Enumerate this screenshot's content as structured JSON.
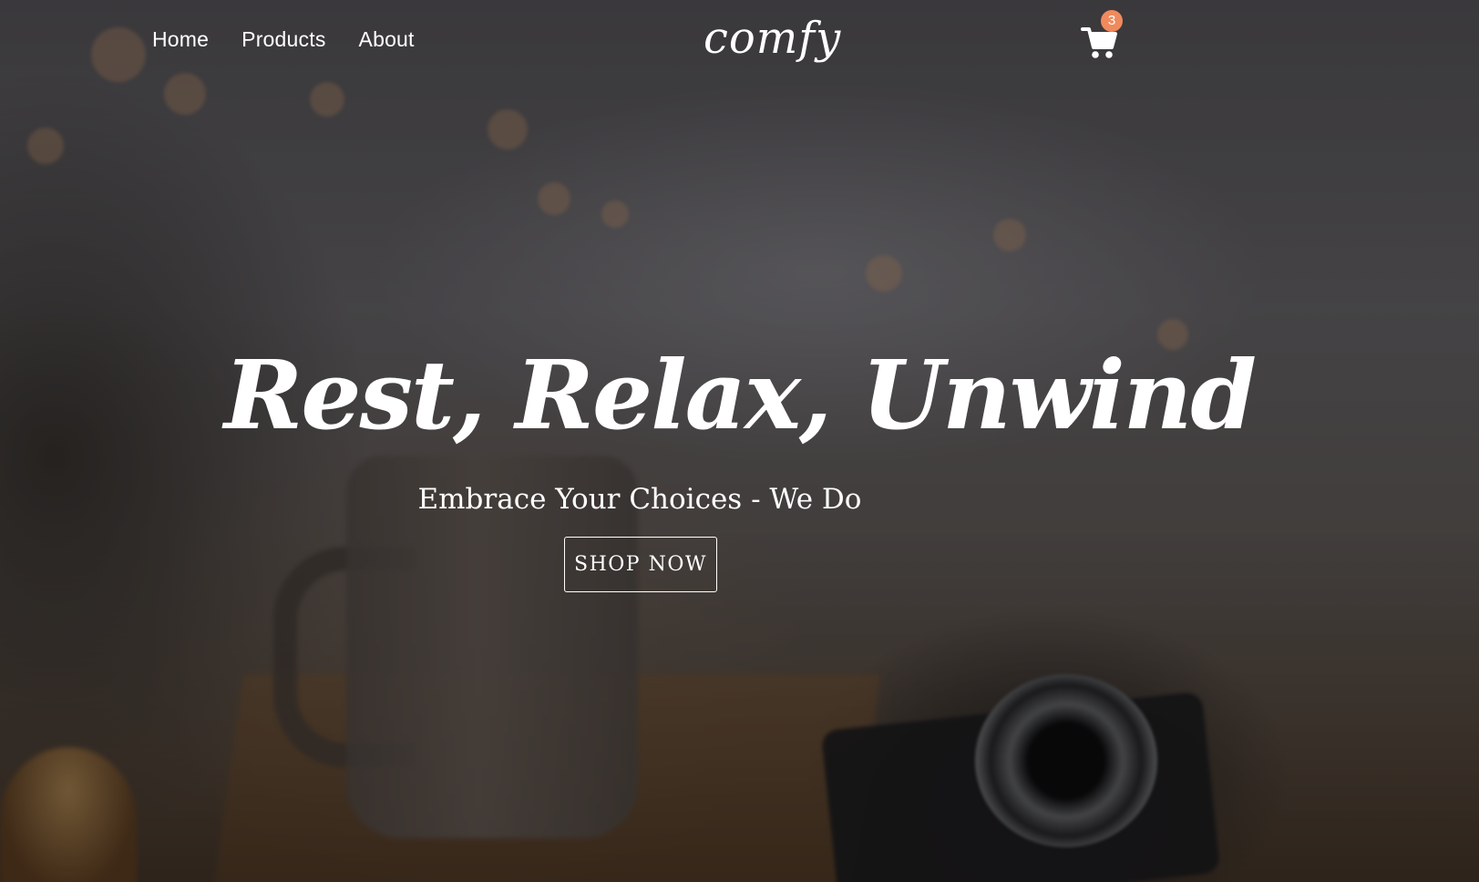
{
  "nav": {
    "links": [
      {
        "label": "Home"
      },
      {
        "label": "Products"
      },
      {
        "label": "About"
      }
    ],
    "logo": "comfy",
    "cart": {
      "icon": "cart-icon",
      "count": "3",
      "badge_color": "#f08a5d"
    }
  },
  "hero": {
    "title": "Rest, Relax, Unwind",
    "subtitle": "Embrace Your Choices - We Do",
    "cta_label": "SHOP NOW"
  }
}
